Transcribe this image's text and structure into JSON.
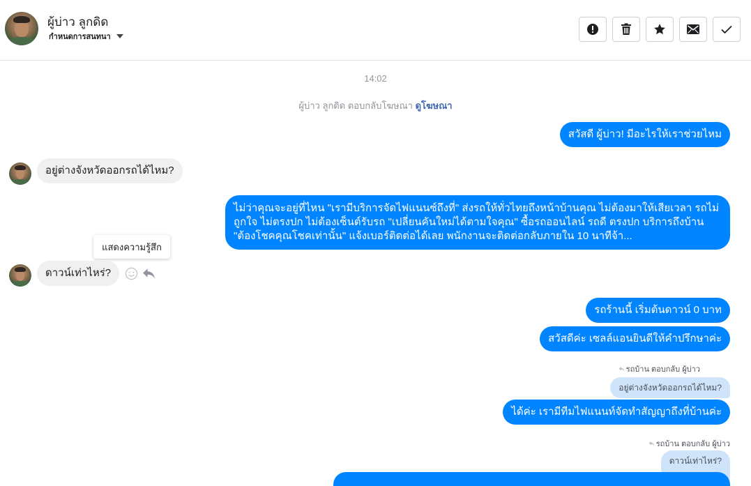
{
  "header": {
    "name": "ผู้บ่าว ลูกดิด",
    "subtitle": "กำหนดการสนทนา",
    "actions": [
      {
        "icon": "alert-icon",
        "name": "spam-button"
      },
      {
        "icon": "trash-icon",
        "name": "delete-button"
      },
      {
        "icon": "star-icon",
        "name": "star-button"
      },
      {
        "icon": "envelope-icon",
        "name": "mark-unread-button"
      },
      {
        "icon": "check-icon",
        "name": "mark-done-button"
      }
    ]
  },
  "conversation": {
    "timestamp": "14:02",
    "reply_note_prefix": "ผู้บ่าว ลูกดิด ตอบกลับโฆษณา",
    "reply_note_link": "ดูโฆษณา",
    "tooltip": "แสดงความรู้สึก",
    "messages": {
      "out1": "สวัสดี ผู้บ่าว! มีอะไรให้เราช่วยไหม",
      "in1": "อยู่ต่างจังหวัดออกรถได้ไหม?",
      "out2": "ไม่ว่าคุณจะอยู่ที่ไหน \"เรามีบริการจัดไฟแนนซ์ถึงที่\"  ส่งรถให้ทั่วไทยถึงหน้าบ้านคุณ ไม่ต้องมาให้เสียเวลา รถไม่ถูกใจ ไม่ตรงปก ไม่ต้องเซ็นต์รับรถ \"เปลี่ยนคันใหม่ได้ตามใจคุณ\" ซื้อรถออนไลน์ รถดี ตรงปก บริการถึงบ้าน \"ต้องโชคคุณโชคเท่านั้น\" แจ้งเบอร์ติดต่อได้เลย พนักงานจะติดต่อกลับภายใน 10 นาทีจ้า...",
      "in2": "ดาวน์เท่าไหร่?",
      "out3": "รถร้านนี้ เริ่มต้นดาวน์ 0 บาท",
      "out4": "สวัสดีค่ะ เซลล์แอนยินดีให้คำปรึกษาค่ะ",
      "reply1_note": "รถบ้าน ตอบกลับ ผู้บ่าว",
      "reply1_quote": "อยู่ต่างจังหวัดออกรถได้ไหม?",
      "out5": "ได้ค่ะ เรามีทีมไฟแนนท์จัดทำสัญญาถึงที่บ้านค่ะ",
      "reply2_note": "รถบ้าน ตอบกลับ ผู้บ่าว",
      "reply2_quote": "ดาวน์เท่าไหร่?"
    }
  },
  "colors": {
    "outgoing": "#0084ff",
    "incoming": "#f1f0f0",
    "quote": "#cfe4fb",
    "link": "#4267b2"
  }
}
